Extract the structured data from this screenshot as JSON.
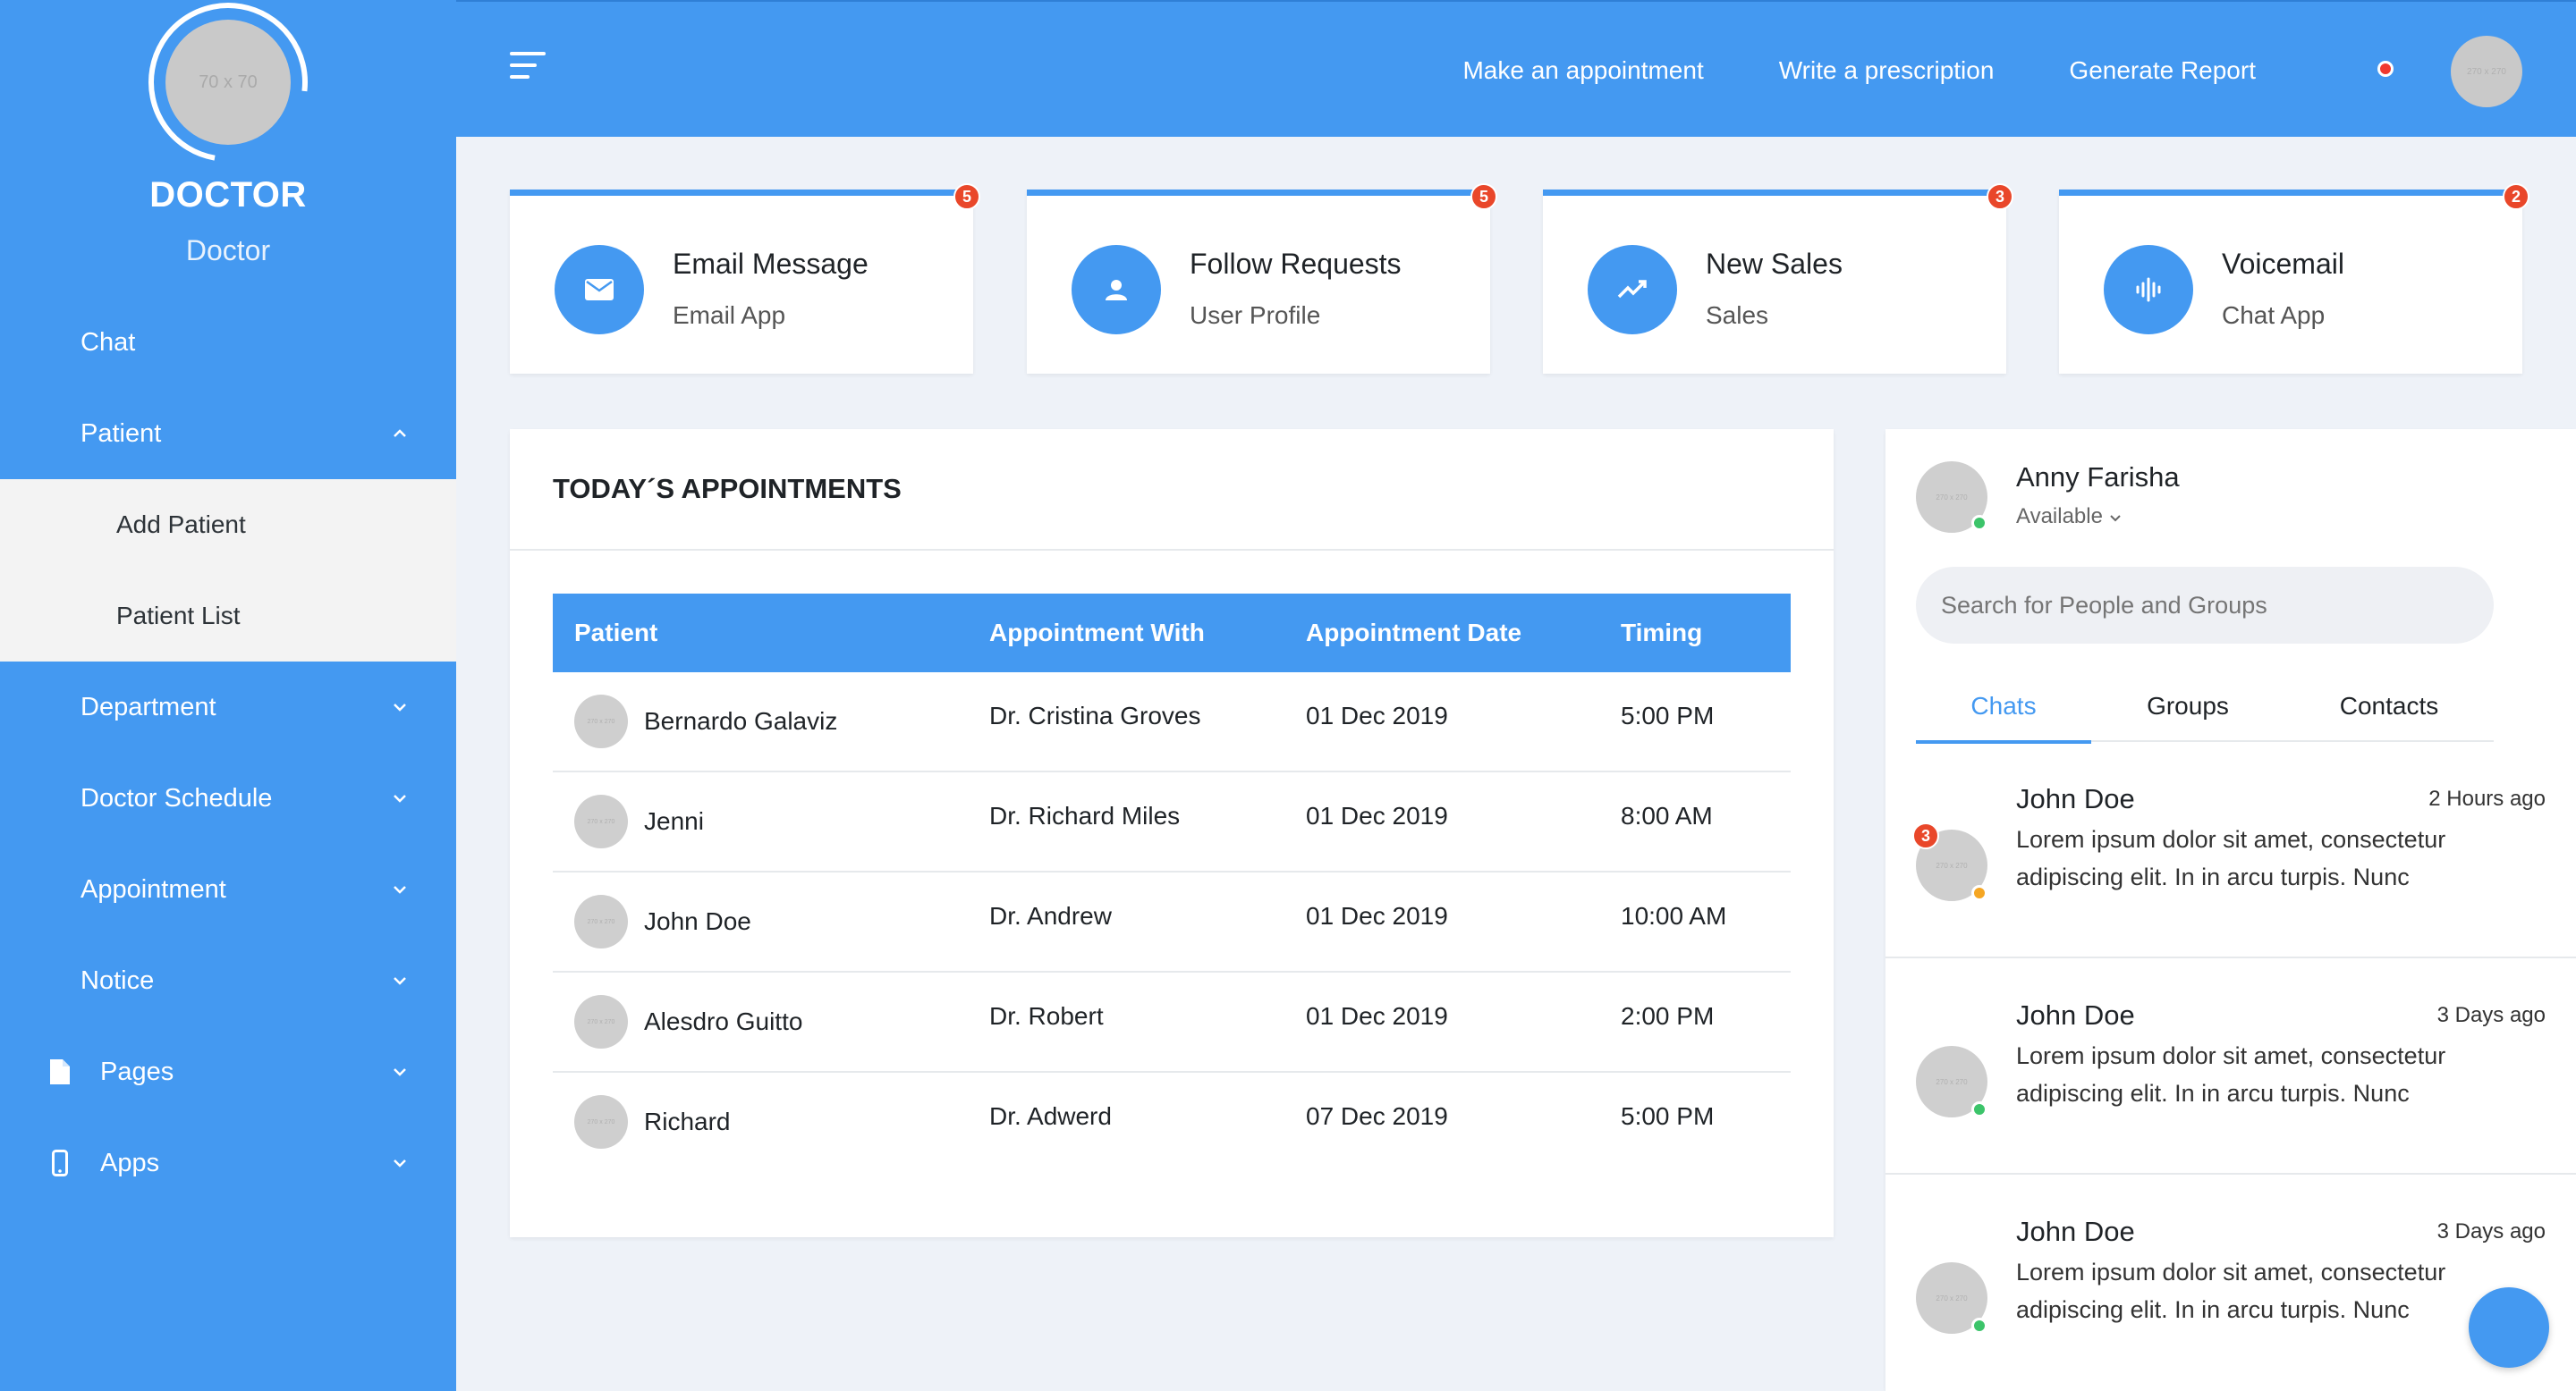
{
  "sidebar": {
    "avatar_placeholder": "70 x 70",
    "title": "DOCTOR",
    "subtitle": "Doctor",
    "items": [
      {
        "label": "Chat"
      },
      {
        "label": "Patient"
      },
      {
        "label": "Add Patient"
      },
      {
        "label": "Patient List"
      },
      {
        "label": "Department"
      },
      {
        "label": "Doctor Schedule"
      },
      {
        "label": "Appointment"
      },
      {
        "label": "Notice"
      },
      {
        "label": "Pages",
        "icon": "file-icon"
      },
      {
        "label": "Apps",
        "icon": "mobile-icon"
      }
    ]
  },
  "topbar": {
    "links": [
      "Make an appointment",
      "Write a prescription",
      "Generate Report"
    ],
    "avatar_placeholder": "270 x 270",
    "notification_color": "#f1392f"
  },
  "cards": [
    {
      "title": "Email Message",
      "subtitle": "Email App",
      "badge": "5",
      "icon": "envelope-icon"
    },
    {
      "title": "Follow Requests",
      "subtitle": "User Profile",
      "badge": "5",
      "icon": "user-icon"
    },
    {
      "title": "New Sales",
      "subtitle": "Sales",
      "badge": "3",
      "icon": "trend-up-icon"
    },
    {
      "title": "Voicemail",
      "subtitle": "Chat App",
      "badge": "2",
      "icon": "voicemail-icon"
    }
  ],
  "appointments": {
    "title": "TODAY´S APPOINTMENTS",
    "columns": [
      "Patient",
      "Appointment With",
      "Appointment Date",
      "Timing"
    ],
    "avatar_placeholder": "270 x 270",
    "rows": [
      {
        "patient": "Bernardo Galaviz",
        "with": "Dr. Cristina Groves",
        "date": "01 Dec 2019",
        "time": "5:00 PM"
      },
      {
        "patient": "Jenni",
        "with": "Dr. Richard Miles",
        "date": "01 Dec 2019",
        "time": "8:00 AM"
      },
      {
        "patient": "John Doe",
        "with": "Dr. Andrew",
        "date": "01 Dec 2019",
        "time": "10:00 AM"
      },
      {
        "patient": "Alesdro Guitto",
        "with": "Dr. Robert",
        "date": "01 Dec 2019",
        "time": "2:00 PM"
      },
      {
        "patient": "Richard",
        "with": "Dr. Adwerd",
        "date": "07 Dec 2019",
        "time": "5:00 PM"
      }
    ]
  },
  "chat": {
    "user_name": "Anny Farisha",
    "user_status": "Available",
    "avatar_placeholder": "270 x 270",
    "search_placeholder": "Search for People and Groups",
    "tabs": [
      "Chats",
      "Groups",
      "Contacts"
    ],
    "messages": [
      {
        "name": "John Doe",
        "time": "2 Hours ago",
        "text": "Lorem ipsum dolor sit amet, consectetur adipiscing elit. In in arcu turpis. Nunc",
        "badge": "3",
        "status_color": "#f5a623"
      },
      {
        "name": "John Doe",
        "time": "3 Days ago",
        "text": "Lorem ipsum dolor sit amet, consectetur adipiscing elit. In in arcu turpis. Nunc",
        "status_color": "#3cc46a"
      },
      {
        "name": "John Doe",
        "time": "3 Days ago",
        "text": "Lorem ipsum dolor sit amet, consectetur adipiscing elit. In in arcu turpis. Nunc",
        "status_color": "#3cc46a"
      }
    ]
  },
  "colors": {
    "primary": "#4499f1",
    "badge": "#e9472a",
    "online": "#3cc46a",
    "away": "#f5a623"
  }
}
